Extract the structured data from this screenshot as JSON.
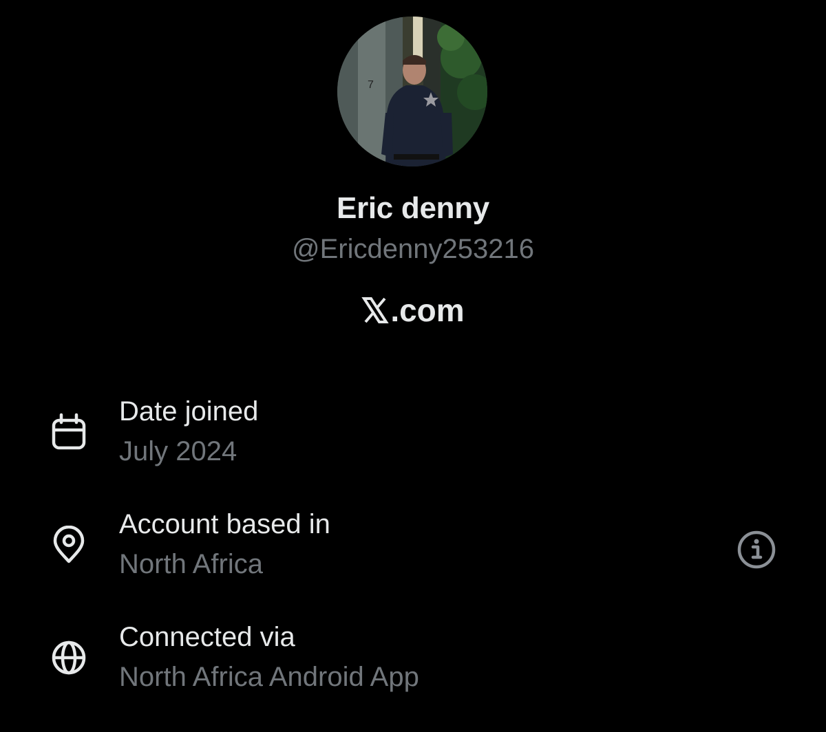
{
  "profile": {
    "name": "Eric denny",
    "handle": "@Ericdenny253216",
    "site": ".com",
    "site_icon": "x-logo-icon"
  },
  "details": [
    {
      "icon": "calendar-icon",
      "label": "Date joined",
      "value": "July 2024"
    },
    {
      "icon": "location-pin-icon",
      "label": "Account based in",
      "value": "North Africa"
    },
    {
      "icon": "globe-icon",
      "label": "Connected via",
      "value": "North Africa Android App"
    }
  ],
  "colors": {
    "background": "#000000",
    "primary_text": "#e7e9ea",
    "secondary_text": "#71767b",
    "info_icon": "#8b9096"
  }
}
